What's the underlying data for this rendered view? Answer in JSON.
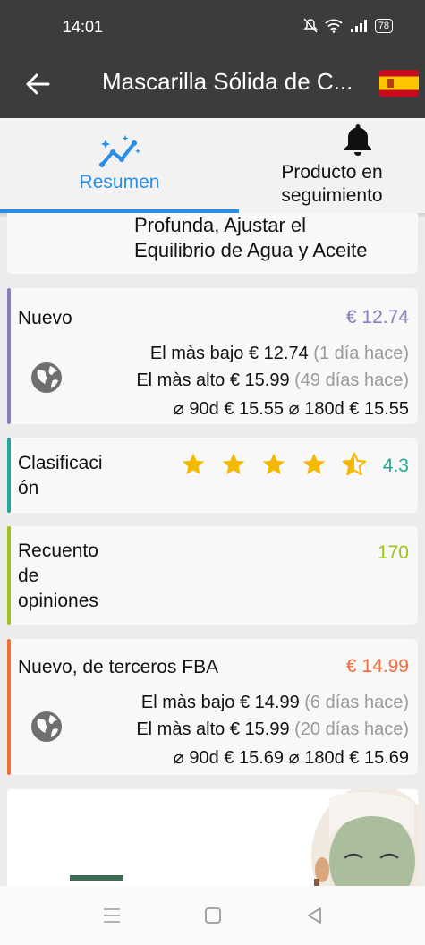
{
  "status_bar": {
    "time": "14:01",
    "battery": "78"
  },
  "app_bar": {
    "title": "Mascarilla Sólida de C...",
    "flag_icon": "spain-flag-icon"
  },
  "tabs": [
    {
      "label": "Resumen",
      "icon": "chart-trend-icon",
      "active": true
    },
    {
      "label_line1": "Producto en",
      "label_line2": "seguimiento",
      "icon": "bell-icon",
      "active": false
    }
  ],
  "description": {
    "line1": "Profunda, Ajustar el",
    "line2": "Equilibrio de Agua y Aceite"
  },
  "cards": {
    "nuevo": {
      "title": "Nuevo",
      "price": "€ 12.74",
      "accent": "#8e7cc3",
      "lowest_label": "El màs bajo",
      "lowest_value": "€ 12.74",
      "lowest_when": "(1 día hace)",
      "highest_label": "El màs alto",
      "highest_value": "€ 15.99",
      "highest_when": "(49 días hace)",
      "avg_90_label": "⌀ 90d",
      "avg_90_value": "€ 15.55",
      "avg_180_label": "⌀ 180d",
      "avg_180_value": "€ 15.55"
    },
    "rating": {
      "title_line1": "Clasificaci",
      "title_line2": "ón",
      "value": "4.3",
      "rating_fraction": 0.86,
      "accent": "#26a69a"
    },
    "reviews": {
      "title_line1": "Recuento",
      "title_line2": "de",
      "title_line3": "opiniones",
      "value": "170",
      "accent": "#9cc31e"
    },
    "fba": {
      "title": "Nuevo, de terceros FBA",
      "price": "€ 14.99",
      "accent": "#f26b3a",
      "lowest_label": "El màs bajo",
      "lowest_value": "€ 14.99",
      "lowest_when": "(6 días hace)",
      "highest_label": "El màs alto",
      "highest_value": "€ 15.99",
      "highest_when": "(20 días hace)",
      "avg_90_label": "⌀ 90d",
      "avg_90_value": "€ 15.69",
      "avg_180_label": "⌀ 180d",
      "avg_180_value": "€ 15.69"
    }
  },
  "colors": {
    "header": "#3c3c3c",
    "accent_blue": "#2b8ee6",
    "star": "#f5b800"
  }
}
